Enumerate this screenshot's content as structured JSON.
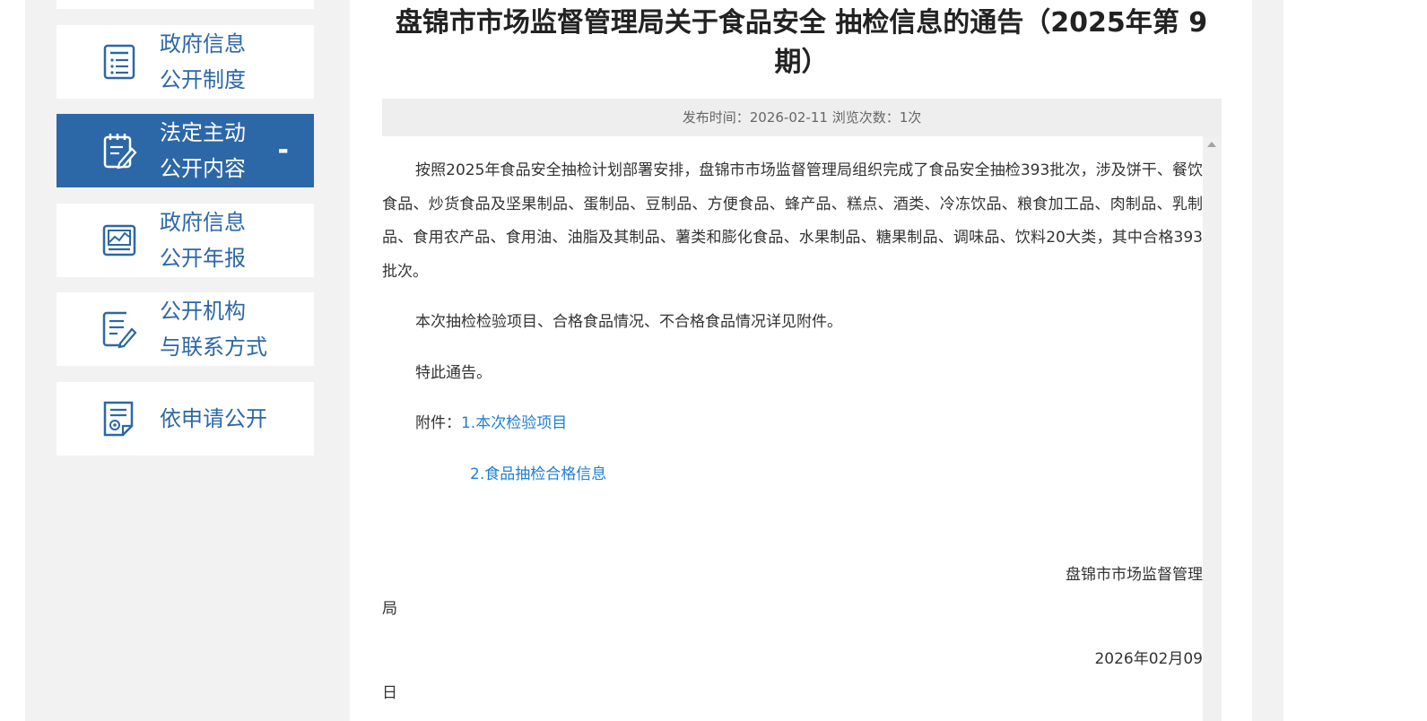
{
  "sidebar": {
    "items": [
      {
        "label": "政府信息\n公开制度",
        "icon": "list-document-icon",
        "active": false
      },
      {
        "label": "法定主动\n公开内容",
        "icon": "edit-notepad-icon",
        "active": true,
        "toggle": "-"
      },
      {
        "label": "政府信息\n公开年报",
        "icon": "chart-report-icon",
        "active": false
      },
      {
        "label": "公开机构\n与联系方式",
        "icon": "document-edit-icon",
        "active": false
      },
      {
        "label": "依申请公开",
        "icon": "application-form-icon",
        "active": false
      }
    ]
  },
  "article": {
    "title": "盘锦市市场监督管理局关于食品安全 抽检信息的通告（2025年第 9期）",
    "meta": "发布时间：2026-02-11 浏览次数：1次",
    "paragraphs": [
      "按照2025年食品安全抽检计划部署安排，盘锦市市场监督管理局组织完成了食品安全抽检393批次，涉及饼干、餐饮食品、炒货食品及坚果制品、蛋制品、豆制品、方便食品、蜂产品、糕点、酒类、冷冻饮品、粮食加工品、肉制品、乳制品、食用农产品、食用油、油脂及其制品、薯类和膨化食品、水果制品、糖果制品、调味品、饮料20大类，其中合格393批次。",
      "本次抽检检验项目、合格食品情况、不合格食品情况详见附件。",
      "特此通告。"
    ],
    "attachment_label": "附件：",
    "attachments": [
      "1.本次检验项目",
      "2.食品抽检合格信息"
    ],
    "signature_line1": "盘锦市市场监督管理",
    "signature_line2": "局",
    "date_line1": "2026年02月09",
    "date_line2": "日"
  }
}
